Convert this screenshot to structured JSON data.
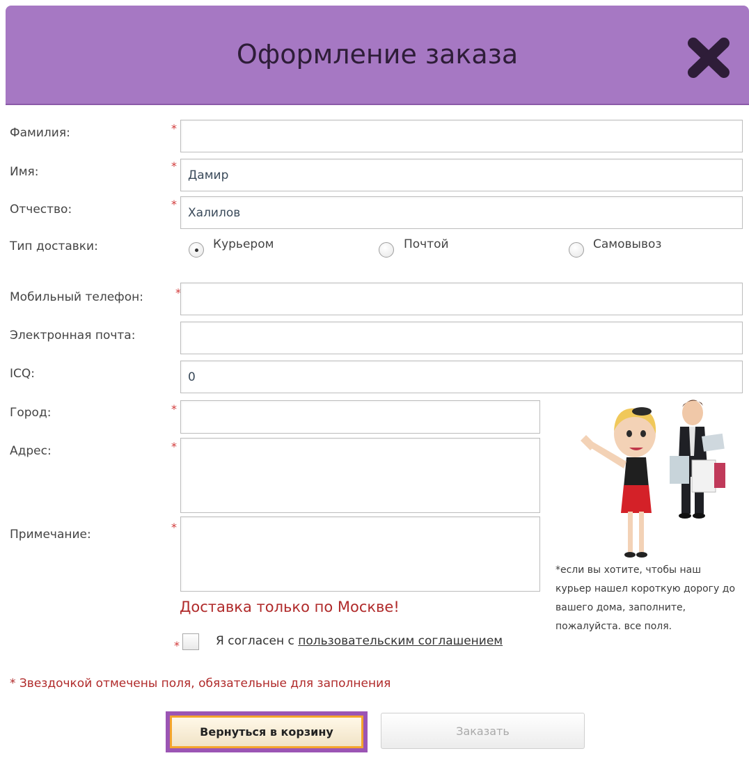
{
  "dialog": {
    "title": "Оформление заказа",
    "close_icon": "close-icon",
    "header_color": "#a678c3"
  },
  "form": {
    "required_mark": "*",
    "last_name": {
      "label": "Фамилия:",
      "value": ""
    },
    "first_name": {
      "label": "Имя:",
      "value": "Дамир"
    },
    "middle_name": {
      "label": "Отчество:",
      "value": "Халилов"
    },
    "delivery": {
      "label": "Тип доставки:",
      "options": [
        "Курьером",
        "Почтой",
        "Самовывоз"
      ],
      "selected": "Курьером"
    },
    "mobile": {
      "label": "Мобильный телефон:",
      "value": ""
    },
    "email": {
      "label": "Электронная почта:",
      "value": ""
    },
    "icq": {
      "label": "ICQ:",
      "value": "0"
    },
    "city": {
      "label": "Город:",
      "value": ""
    },
    "address": {
      "label": "Адрес:",
      "value": ""
    },
    "note": {
      "label": "Примечание:",
      "value": ""
    }
  },
  "promo": {
    "text": "*если вы хотите, чтобы наш курьер нашел короткую дорогу до вашего дома, заполните, пожалуйста. все поля."
  },
  "delivery_note": "Доставка только по Москве!",
  "agreement": {
    "text": "Я согласен с",
    "link": "пользовательским соглашением",
    "checked": false
  },
  "required_note": "* Звездочкой отмечены поля, обязательные для заполнения",
  "buttons": {
    "back": "Вернуться в корзину",
    "order": "Заказать"
  }
}
